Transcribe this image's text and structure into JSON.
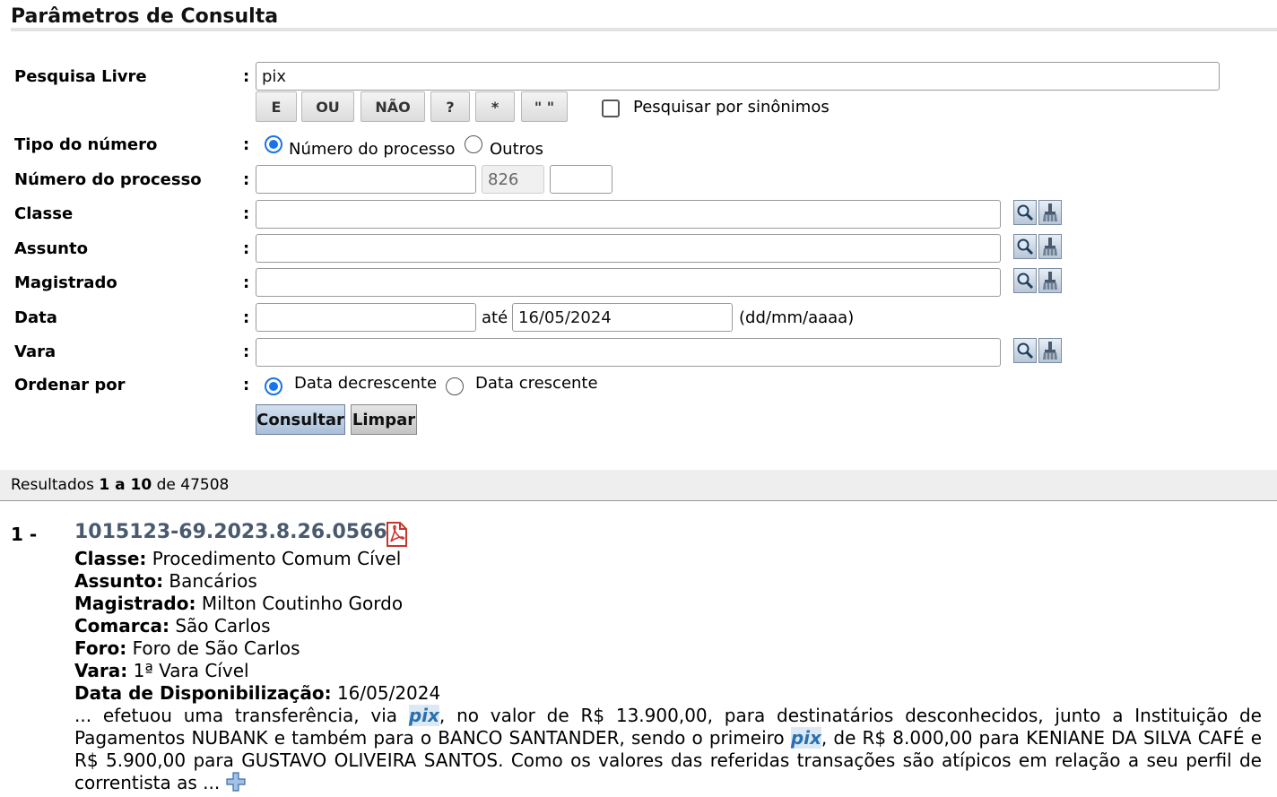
{
  "header": {
    "title": "Parâmetros de Consulta"
  },
  "form": {
    "free_search": {
      "label": "Pesquisa Livre",
      "value": "pix"
    },
    "operators": [
      "E",
      "OU",
      "NÃO",
      "?",
      "*",
      "\" \""
    ],
    "synonyms_label": "Pesquisar por sinônimos",
    "number_type": {
      "label": "Tipo do número",
      "option_process": "Número do processo",
      "option_other": "Outros"
    },
    "process_number": {
      "label": "Número do processo",
      "part1": "",
      "part2": "826",
      "part3": ""
    },
    "classe": {
      "label": "Classe",
      "value": ""
    },
    "assunto": {
      "label": "Assunto",
      "value": ""
    },
    "magistrado": {
      "label": "Magistrado",
      "value": ""
    },
    "data": {
      "label": "Data",
      "from": "",
      "until_label": "até",
      "to": "16/05/2024",
      "format_hint": "(dd/mm/aaaa)"
    },
    "vara": {
      "label": "Vara",
      "value": ""
    },
    "order": {
      "label": "Ordenar por",
      "desc": "Data decrescente",
      "asc": "Data crescente"
    },
    "colon": ":",
    "submit_label": "Consultar",
    "clear_label": "Limpar"
  },
  "results": {
    "summary_prefix": "Resultados",
    "range": "1 a 10",
    "of": "de",
    "total": "47508",
    "items": [
      {
        "index": "1 -",
        "process": "1015123-69.2023.8.26.0566",
        "classe_label": "Classe:",
        "classe": "Procedimento Comum Cível",
        "assunto_label": "Assunto:",
        "assunto": "Bancários",
        "magistrado_label": "Magistrado:",
        "magistrado": "Milton Coutinho Gordo",
        "comarca_label": "Comarca:",
        "comarca": "São Carlos",
        "foro_label": "Foro:",
        "foro": "Foro de São Carlos",
        "vara_label": "Vara:",
        "vara": "1ª Vara Cível",
        "data_label": "Data de Disponibilização:",
        "data": "16/05/2024",
        "excerpt_1": "... efetuou uma transferência, via ",
        "highlight": "pix",
        "excerpt_2": ", no valor de R$ 13.900,00, para destinatários desconhecidos, junto a Instituição de Pagamentos NUBANK e também para o BANCO SANTANDER, sendo o primeiro ",
        "excerpt_3": ", de R$ 8.000,00 para KENIANE DA SILVA CAFÉ e R$ 5.900,00 para GUSTAVO OLIVEIRA SANTOS. Como os valores das referidas transações são atípicos em relação a seu perfil de correntista as ..."
      }
    ]
  },
  "colors": {
    "link": "#4a5a6e",
    "highlight": "#2a6fb0",
    "radio": "#1a73e8",
    "consult_btn": "#b9cde4"
  }
}
